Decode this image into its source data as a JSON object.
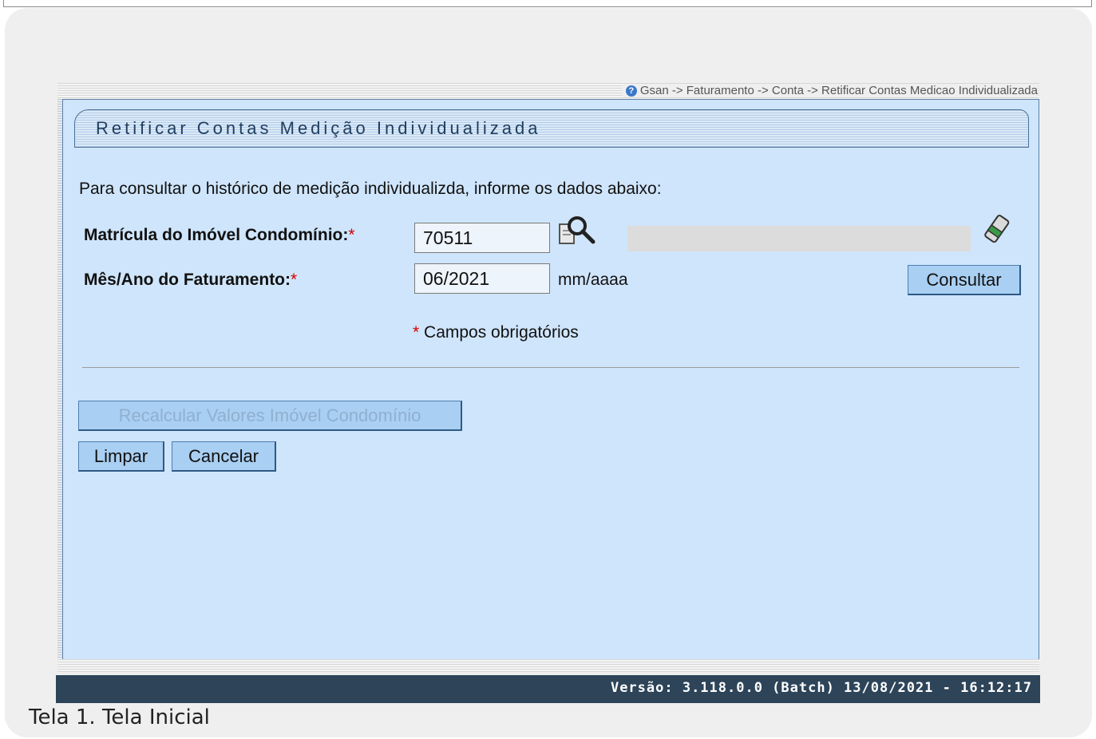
{
  "breadcrumb": "Gsan -> Faturamento -> Conta -> Retificar Contas Medicao Individualizada",
  "panel": {
    "title": "Retificar Contas Medição Individualizada",
    "instructions": "Para consultar o histórico de medição individualizda, informe os dados abaixo:"
  },
  "form": {
    "matricula_label": "Matrícula do Imóvel Condomínio:",
    "matricula_value": "70511",
    "mes_ano_label": "Mês/Ano do Faturamento:",
    "mes_ano_value": "06/2021",
    "mes_ano_unit": "mm/aaaa",
    "required_mark": "*",
    "required_note": "Campos obrigatórios"
  },
  "buttons": {
    "consultar": "Consultar",
    "recalcular": "Recalcular Valores Imóvel Condomínio",
    "limpar": "Limpar",
    "cancelar": "Cancelar"
  },
  "footer": {
    "version": "Versão: 3.118.0.0 (Batch) 13/08/2021 - 16:12:17"
  },
  "caption": "Tela 1. Tela Inicial",
  "icons": {
    "help": "help-icon",
    "search": "search-icon",
    "eraser": "eraser-icon"
  }
}
